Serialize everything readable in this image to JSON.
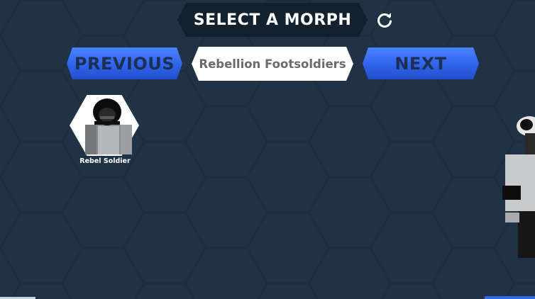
{
  "title": "SELECT A MORPH",
  "nav": {
    "previous_label": "PREVIOUS",
    "next_label": "NEXT",
    "category_label": "Rebellion Footsoldiers"
  },
  "morphs": [
    {
      "name": "Rebel Soldier"
    }
  ],
  "icons": {
    "refresh": "refresh-icon"
  },
  "colors": {
    "background": "#1f3246",
    "title_banner": "#13202d",
    "button_blue": "#3467f0",
    "button_text": "#1d2f55",
    "pill_text": "#6b6b6b"
  }
}
